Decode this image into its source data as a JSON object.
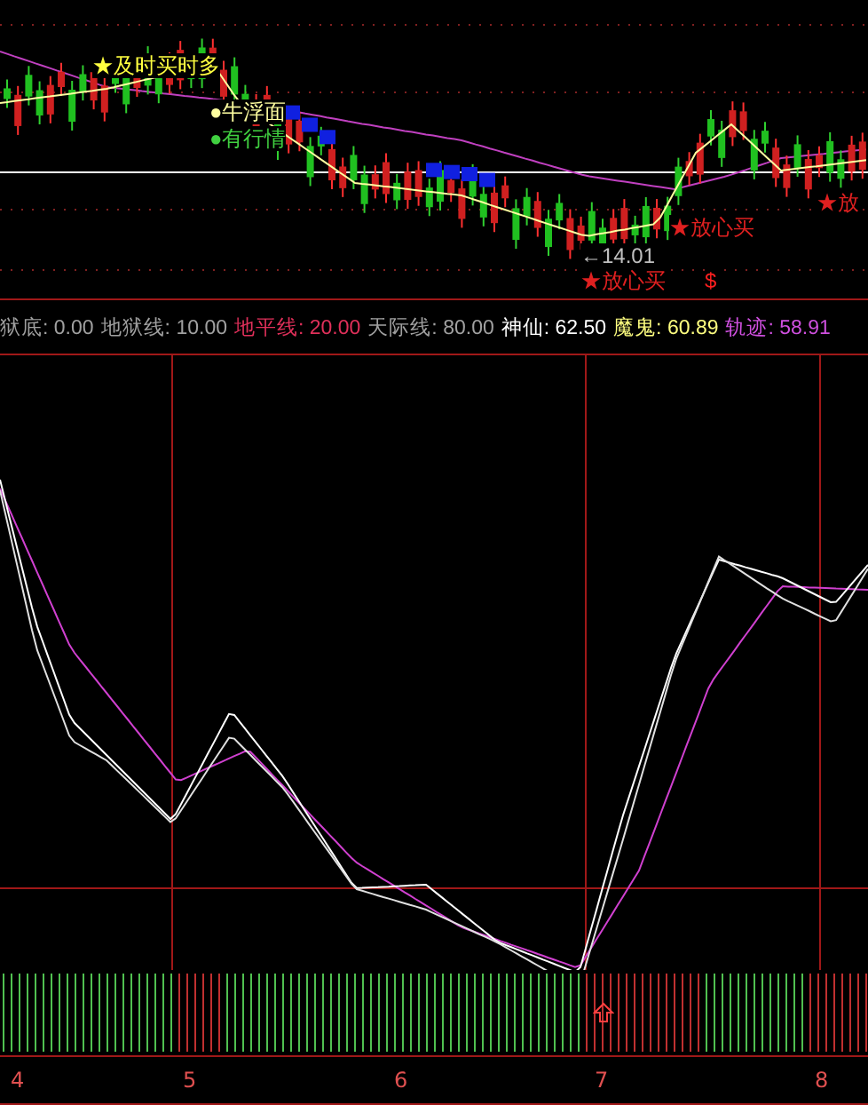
{
  "price_panel": {
    "signals": [
      {
        "text": "★及时买时多",
        "color": "#ffff40"
      },
      {
        "text": "●牛浮面",
        "color": "#ffffa0"
      },
      {
        "text": "●有行情",
        "color": "#40d040"
      },
      {
        "text": "←14.01",
        "color": "#c0c0c0"
      },
      {
        "text": "★放心买",
        "color": "#e02020"
      },
      {
        "text": "★放心买",
        "color": "#e02020"
      },
      {
        "text": "★放",
        "color": "#e02020"
      },
      {
        "text": "$",
        "color": "#ff2020"
      }
    ]
  },
  "indicators": [
    {
      "label": "狱底:",
      "value": "0.00",
      "color": "#a0a0a0"
    },
    {
      "label": "地狱线:",
      "value": "10.00",
      "color": "#a0a0a0"
    },
    {
      "label": "地平线:",
      "value": "20.00",
      "color": "#e0305a"
    },
    {
      "label": "天际线:",
      "value": "80.00",
      "color": "#a0a0a0"
    },
    {
      "label": "神仙:",
      "value": "62.50",
      "color": "#ffffff"
    },
    {
      "label": "魔鬼:",
      "value": "60.89",
      "color": "#ffff80"
    },
    {
      "label": "轨迹:",
      "value": "58.91",
      "color": "#d050e0"
    }
  ],
  "time_axis": [
    "4",
    "5",
    "6",
    "7",
    "8"
  ]
}
